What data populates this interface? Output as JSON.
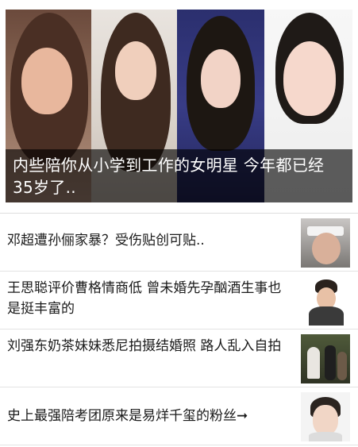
{
  "hero": {
    "caption": "内些陪你从小学到工作的女明星 今年都已经35岁了.."
  },
  "news": [
    {
      "title": "邓超遭孙俪家暴？受伤贴创可贴.."
    },
    {
      "title": "王思聪评价曹格情商低 曾未婚先孕酗酒生事也是挺丰富的"
    },
    {
      "title": "刘强东奶茶妹妹悉尼拍摄结婚照 路人乱入自拍"
    },
    {
      "title": "史上最强陪考团原来是易烊千玺的粉丝➞"
    }
  ]
}
